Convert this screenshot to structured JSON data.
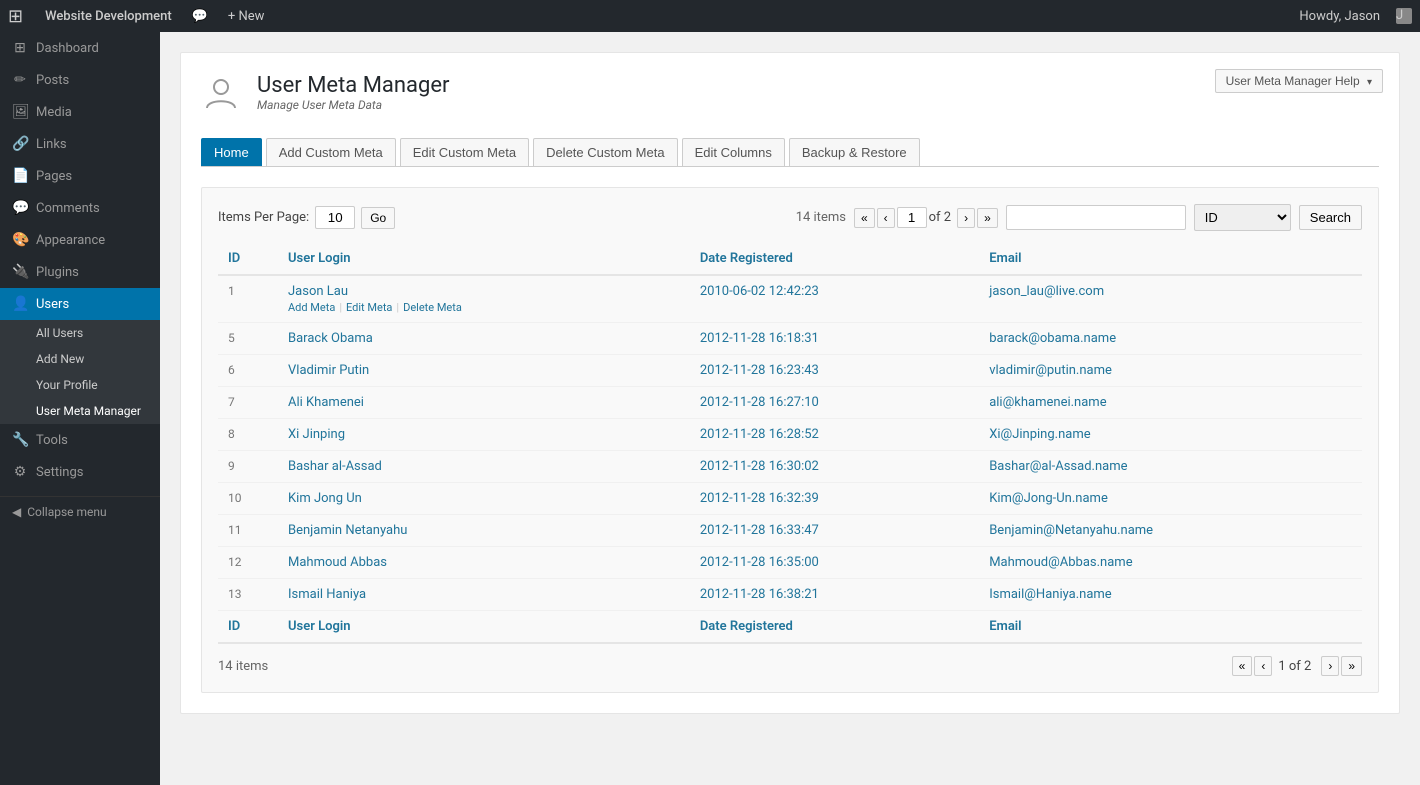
{
  "adminbar": {
    "logo": "W",
    "site_name": "Website Development",
    "comment_icon": "💬",
    "new_label": "+ New",
    "howdy": "Howdy, Jason",
    "avatar_initial": "J"
  },
  "sidebar": {
    "items": [
      {
        "id": "dashboard",
        "label": "Dashboard",
        "icon": "⊞",
        "active": false
      },
      {
        "id": "posts",
        "label": "Posts",
        "icon": "✏",
        "active": false
      },
      {
        "id": "media",
        "label": "Media",
        "icon": "🖼",
        "active": false
      },
      {
        "id": "links",
        "label": "Links",
        "icon": "🔗",
        "active": false
      },
      {
        "id": "pages",
        "label": "Pages",
        "icon": "📄",
        "active": false
      },
      {
        "id": "comments",
        "label": "Comments",
        "icon": "💬",
        "active": false
      },
      {
        "id": "appearance",
        "label": "Appearance",
        "icon": "🎨",
        "active": false
      },
      {
        "id": "plugins",
        "label": "Plugins",
        "icon": "🔌",
        "active": false
      },
      {
        "id": "users",
        "label": "Users",
        "icon": "👤",
        "active": true
      },
      {
        "id": "tools",
        "label": "Tools",
        "icon": "🔧",
        "active": false
      },
      {
        "id": "settings",
        "label": "Settings",
        "icon": "⚙",
        "active": false
      }
    ],
    "users_submenu": [
      {
        "id": "all-users",
        "label": "All Users",
        "active": false
      },
      {
        "id": "add-new",
        "label": "Add New",
        "active": false
      },
      {
        "id": "your-profile",
        "label": "Your Profile",
        "active": false
      },
      {
        "id": "user-meta-manager",
        "label": "User Meta Manager",
        "active": true
      }
    ],
    "collapse_label": "Collapse menu"
  },
  "page": {
    "title": "User Meta Manager",
    "subtitle": "Manage User Meta Data",
    "help_button": "User Meta Manager Help"
  },
  "tabs": [
    {
      "id": "home",
      "label": "Home",
      "active": true
    },
    {
      "id": "add-custom-meta",
      "label": "Add Custom Meta",
      "active": false
    },
    {
      "id": "edit-custom-meta",
      "label": "Edit Custom Meta",
      "active": false
    },
    {
      "id": "delete-custom-meta",
      "label": "Delete Custom Meta",
      "active": false
    },
    {
      "id": "edit-columns",
      "label": "Edit Columns",
      "active": false
    },
    {
      "id": "backup-restore",
      "label": "Backup & Restore",
      "active": false
    }
  ],
  "table_controls": {
    "items_per_page_label": "Items Per Page:",
    "items_per_page_value": "10",
    "go_label": "Go",
    "total_items": "14 items",
    "page_current": "1",
    "page_total": "2",
    "search_placeholder": "",
    "search_select_value": "ID",
    "search_button": "Search"
  },
  "table": {
    "columns": [
      {
        "id": "id",
        "label": "ID"
      },
      {
        "id": "user_login",
        "label": "User Login"
      },
      {
        "id": "date_registered",
        "label": "Date Registered"
      },
      {
        "id": "email",
        "label": "Email"
      }
    ],
    "rows": [
      {
        "id": "1",
        "user_login": "Jason Lau",
        "date_registered": "2010-06-02 12:42:23",
        "email": "jason_lau@live.com",
        "has_actions": true,
        "actions": [
          "Add Meta",
          "Edit Meta",
          "Delete Meta"
        ]
      },
      {
        "id": "5",
        "user_login": "Barack Obama",
        "date_registered": "2012-11-28 16:18:31",
        "email": "barack@obama.name",
        "has_actions": false
      },
      {
        "id": "6",
        "user_login": "Vladimir Putin",
        "date_registered": "2012-11-28 16:23:43",
        "email": "vladimir@putin.name",
        "has_actions": false
      },
      {
        "id": "7",
        "user_login": "Ali Khamenei",
        "date_registered": "2012-11-28 16:27:10",
        "email": "ali@khamenei.name",
        "has_actions": false
      },
      {
        "id": "8",
        "user_login": "Xi Jinping",
        "date_registered": "2012-11-28 16:28:52",
        "email": "Xi@Jinping.name",
        "has_actions": false
      },
      {
        "id": "9",
        "user_login": "Bashar al-Assad",
        "date_registered": "2012-11-28 16:30:02",
        "email": "Bashar@al-Assad.name",
        "has_actions": false
      },
      {
        "id": "10",
        "user_login": "Kim Jong Un",
        "date_registered": "2012-11-28 16:32:39",
        "email": "Kim@Jong-Un.name",
        "has_actions": false
      },
      {
        "id": "11",
        "user_login": "Benjamin Netanyahu",
        "date_registered": "2012-11-28 16:33:47",
        "email": "Benjamin@Netanyahu.name",
        "has_actions": false
      },
      {
        "id": "12",
        "user_login": "Mahmoud Abbas",
        "date_registered": "2012-11-28 16:35:00",
        "email": "Mahmoud@Abbas.name",
        "has_actions": false
      },
      {
        "id": "13",
        "user_login": "Ismail Haniya",
        "date_registered": "2012-11-28 16:38:21",
        "email": "Ismail@Haniya.name",
        "has_actions": false
      }
    ],
    "footer_columns": [
      {
        "id": "id-footer",
        "label": "ID"
      },
      {
        "id": "user_login-footer",
        "label": "User Login"
      },
      {
        "id": "date_registered-footer",
        "label": "Date Registered"
      },
      {
        "id": "email-footer",
        "label": "Email"
      }
    ]
  }
}
